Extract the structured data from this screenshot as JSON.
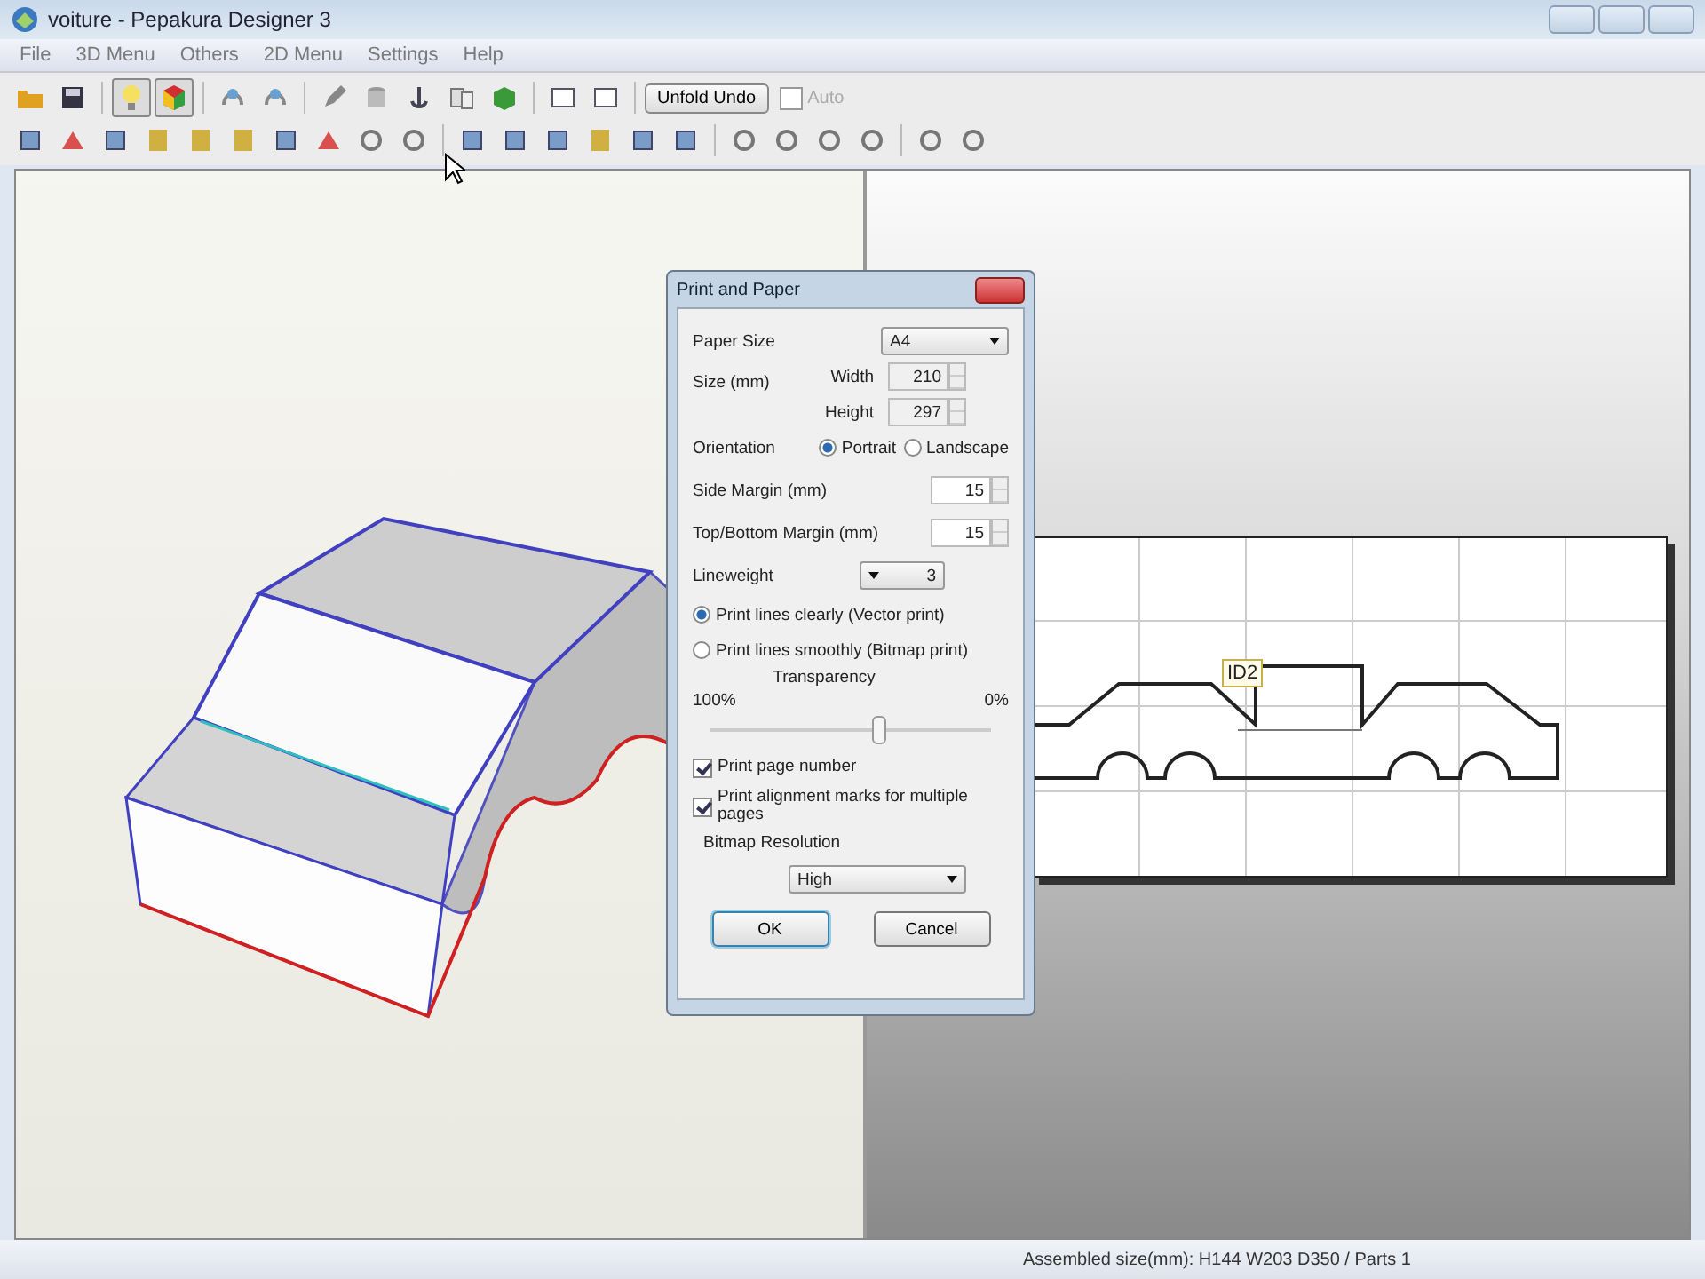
{
  "window": {
    "title": "voiture - Pepakura Designer 3"
  },
  "menu": [
    "File",
    "3D Menu",
    "Others",
    "2D Menu",
    "Settings",
    "Help"
  ],
  "toolbar": {
    "unfold_undo": "Unfold Undo",
    "auto": {
      "label": "Auto",
      "checked": false,
      "disabled": true
    }
  },
  "view_2d": {
    "part_label": "ID2"
  },
  "dialog": {
    "title": "Print and Paper",
    "paper_size": {
      "label": "Paper Size",
      "value": "A4"
    },
    "size": {
      "label": "Size (mm)",
      "width": {
        "label": "Width",
        "value": "210"
      },
      "height": {
        "label": "Height",
        "value": "297"
      }
    },
    "orientation": {
      "label": "Orientation",
      "options": [
        {
          "label": "Portrait",
          "selected": true
        },
        {
          "label": "Landscape",
          "selected": false
        }
      ]
    },
    "side_margin": {
      "label": "Side Margin (mm)",
      "value": "15"
    },
    "top_bottom_margin": {
      "label": "Top/Bottom Margin (mm)",
      "value": "15"
    },
    "lineweight": {
      "label": "Lineweight",
      "value": "3"
    },
    "print_modes": [
      {
        "label": "Print lines clearly (Vector print)",
        "selected": true
      },
      {
        "label": "Print lines smoothly (Bitmap print)",
        "selected": false
      }
    ],
    "transparency": {
      "label": "Transparency",
      "min_label": "100%",
      "max_label": "0%",
      "level": 0.6
    },
    "checkboxes": [
      {
        "label": "Print page number",
        "checked": true
      },
      {
        "label": "Print alignment marks for multiple pages",
        "checked": true
      }
    ],
    "bitmap_resolution": {
      "label": "Bitmap Resolution",
      "value": "High"
    },
    "buttons": [
      "OK",
      "Cancel"
    ]
  },
  "status_bar": {
    "text": "Assembled size(mm): H144 W203 D350 / Parts 1"
  }
}
